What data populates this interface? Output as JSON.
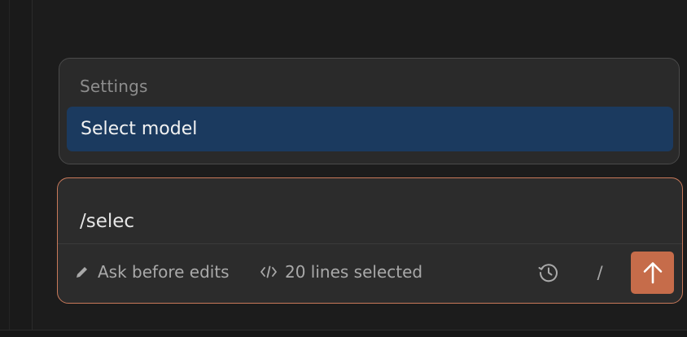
{
  "menu": {
    "section_label": "Settings",
    "items": [
      {
        "label": "Select model",
        "highlighted": true
      }
    ],
    "highlight_color": "#1b3a5f"
  },
  "composer": {
    "value": "/selec",
    "accent_color": "#c8795a",
    "footer": {
      "mode_label": "Ask before edits",
      "mode_icon": "pencil-icon",
      "selection_label": "20 lines selected",
      "selection_icon": "code-icon",
      "history_icon": "history-icon",
      "slash_label": "/",
      "send_icon": "arrow-up-icon",
      "send_color": "#c66c4a"
    }
  }
}
